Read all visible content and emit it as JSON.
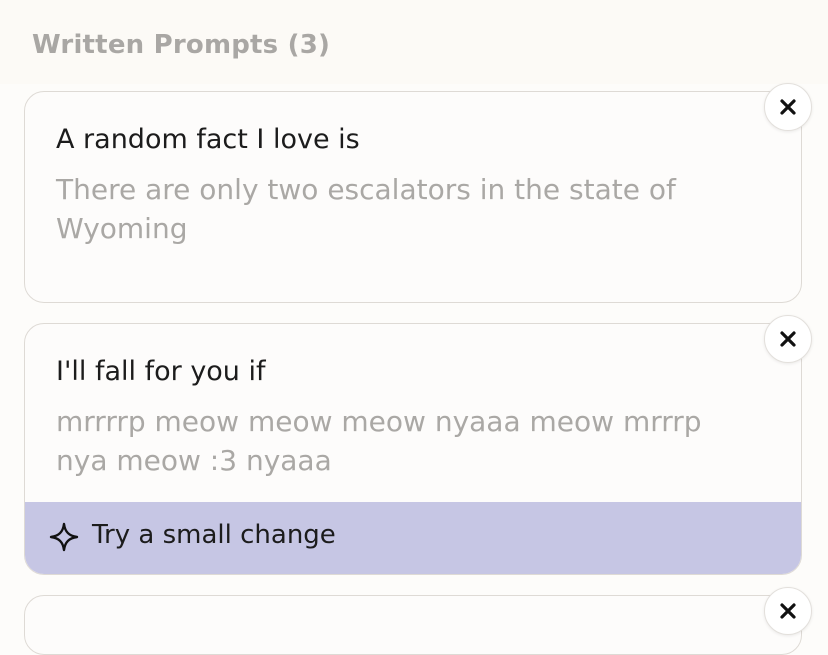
{
  "section": {
    "title": "Written Prompts (3)"
  },
  "prompts": [
    {
      "title": "A random fact I love is",
      "answer": "There are only two escalators in the state of Wyoming"
    },
    {
      "title": "I'll fall for you if",
      "answer": "mrrrrp meow meow meow nyaaa meow mrrrp nya meow :3 nyaaa",
      "suggestion": "Try a small change"
    }
  ],
  "icons": {
    "close": "close-icon",
    "suggestion": "sparkle-icon"
  },
  "colors": {
    "suggestion_bar": "#c6c6e4",
    "answer_text": "#aaa8a5",
    "section_title": "#a9a7a4"
  }
}
